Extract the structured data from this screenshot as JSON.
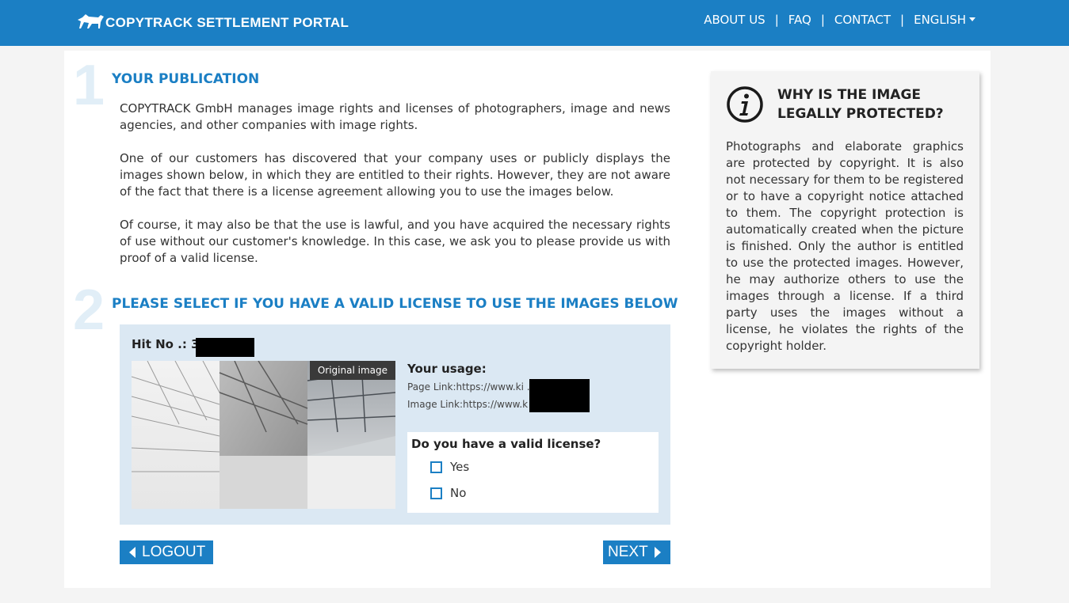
{
  "brand": {
    "name": "COPYTRACK SETTLEMENT PORTAL"
  },
  "nav": {
    "about": "ABOUT US",
    "faq": "FAQ",
    "contact": "CONTACT",
    "language": "ENGLISH",
    "separator": "|"
  },
  "section1": {
    "number": "1",
    "title": "YOUR PUBLICATION",
    "paragraphs": [
      "COPYTRACK GmbH manages image rights and licenses of photographers, image and news agencies, and other companies with image rights.",
      "One of our customers has discovered that your company uses or publicly displays the images shown below, in which they are entitled to their rights. However, they are not aware of the fact that there is a license agreement allowing you to use the images below.",
      "Of course, it may also be that the use is lawful, and you have acquired the necessary rights of use without our customer's knowledge. In this case, we ask you to please provide us with proof of a valid license."
    ]
  },
  "section2": {
    "number": "2",
    "title": "PLEASE SELECT IF YOU HAVE A VALID LICENSE TO USE THE IMAGES BELOW"
  },
  "hit": {
    "label": "Hit No .: 36",
    "image_badge": "Original image",
    "usage_title": "Your usage:",
    "page_link": "Page Link:https://www.ki                 .tw/",
    "image_link": "Image Link:https://www.k                 m.tw/...",
    "license_question": "Do you have a valid license?",
    "options": [
      "Yes",
      "No"
    ]
  },
  "buttons": {
    "logout": "LOGOUT",
    "next": "NEXT"
  },
  "info": {
    "title": "WHY IS THE IMAGE LEGALLY PROTECTED?",
    "text": "Photographs and elaborate graphics are protected by copyright. It is also not necessary for them to be registered or to have a copyright notice attached to them. The copyright protection is automatically created when the picture is finished. Only the author is entitled to use the protected images. However, he may authorize others to use the images through a license. If a third party uses the images without a license, he violates the rights of the copyright holder."
  },
  "colors": {
    "primary": "#1b7fc4",
    "step_number": "#e1eef7",
    "hit_background": "#dbe8f3"
  }
}
